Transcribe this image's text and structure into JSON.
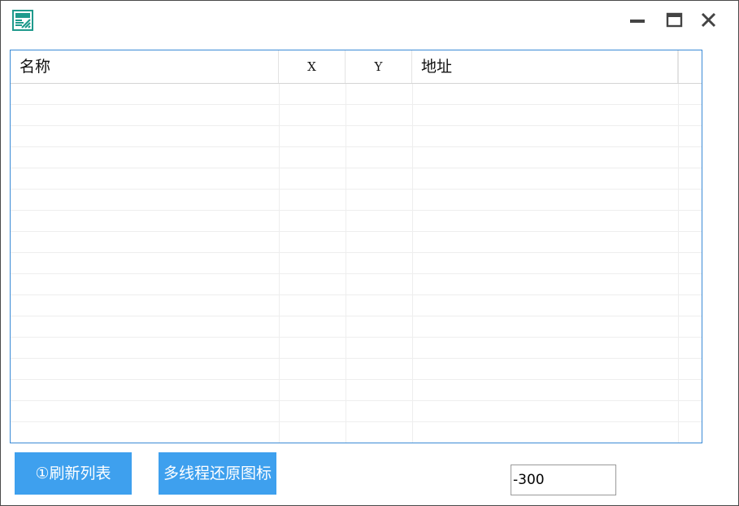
{
  "window": {
    "icon": "app-logo-icon",
    "controls": {
      "minimize_icon": "minimize-icon",
      "maximize_icon": "maximize-icon",
      "close_icon": "close-icon"
    }
  },
  "list": {
    "columns": [
      "名称",
      "X",
      "Y",
      "地址"
    ],
    "rows": []
  },
  "buttons": {
    "refresh_label": "①刷新列表",
    "restore_label": "多线程还原图标"
  },
  "input": {
    "value": "-300"
  },
  "colors": {
    "accent": "#3ea0ee",
    "list_border": "#3a8ad6",
    "icon_teal": "#1f9a8c"
  }
}
